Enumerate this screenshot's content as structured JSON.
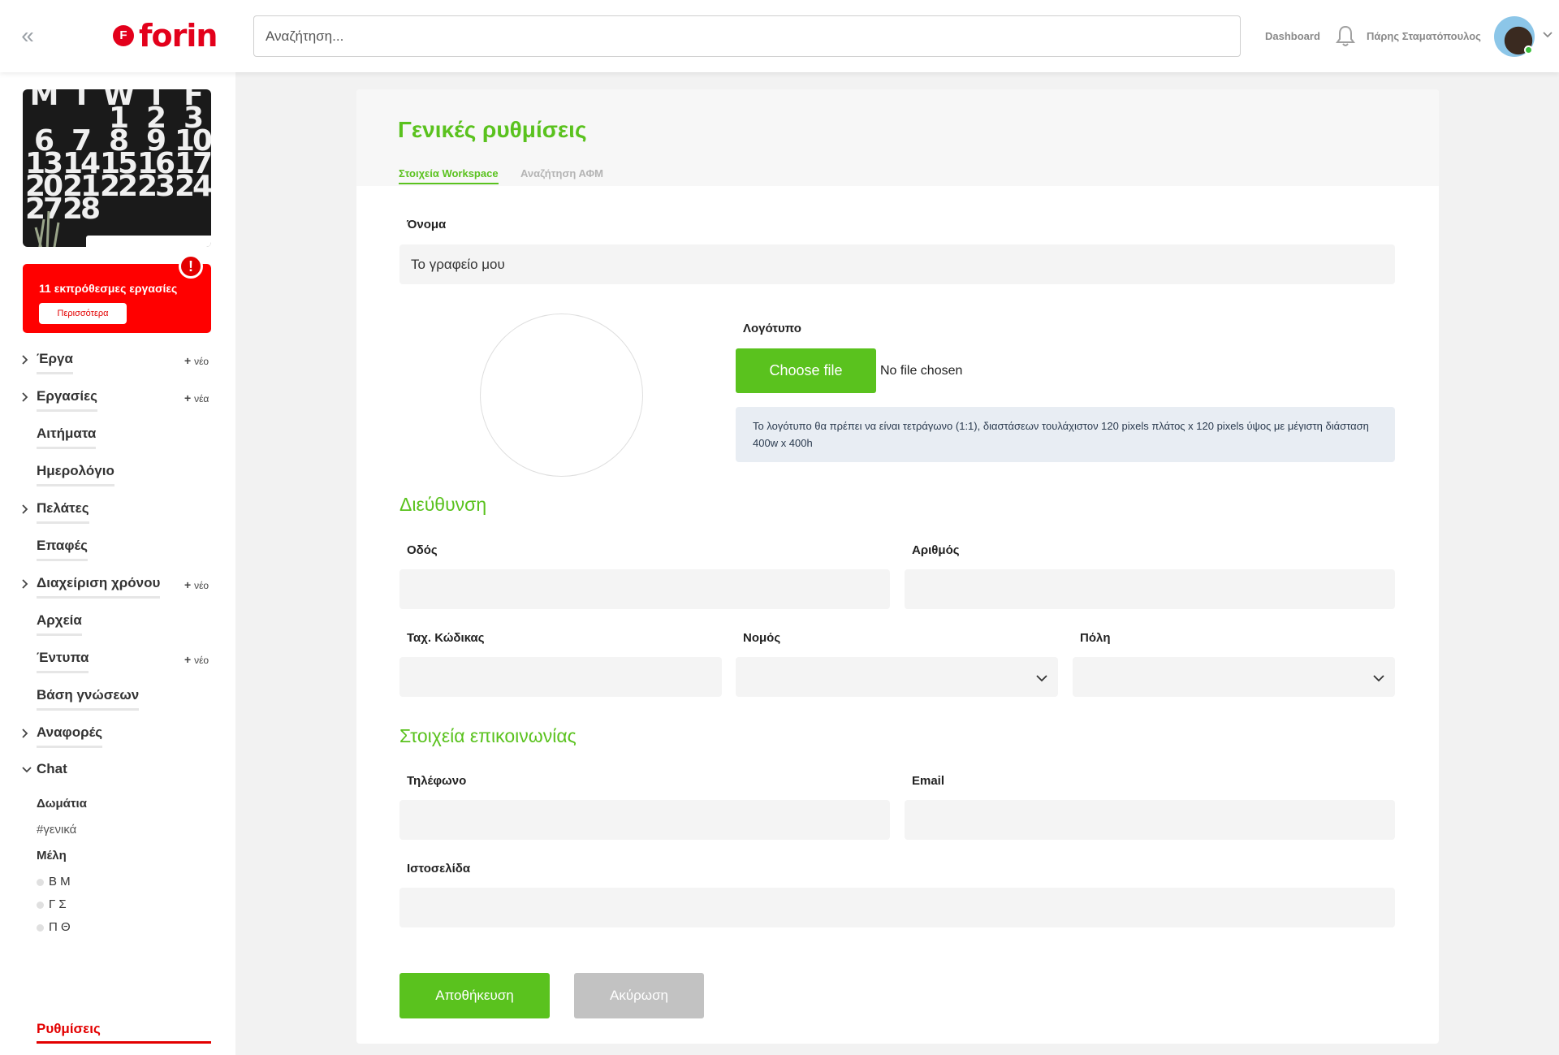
{
  "header": {
    "logo_text": "forin",
    "logo_mark": "F",
    "search_placeholder": "Αναζήτηση...",
    "dashboard_label": "Dashboard",
    "user_name": "Πάρης Σταματόπουλος",
    "icons": [
      "double-chevron-left-icon",
      "bell-icon",
      "chevron-down-icon"
    ]
  },
  "sidebar": {
    "calendar": {
      "rows": [
        [
          "M",
          "T",
          "W",
          "T",
          "F"
        ],
        [
          "",
          "",
          "1",
          "2",
          "3"
        ],
        [
          "6",
          "7",
          "8",
          "9",
          "10"
        ],
        [
          "13",
          "14",
          "15",
          "16",
          "17"
        ],
        [
          "20",
          "21",
          "22",
          "23",
          "24"
        ],
        [
          "27",
          "28",
          "",
          "",
          ""
        ]
      ]
    },
    "alert": {
      "text": "11 εκπρόθεσμες εργασίες",
      "button": "Περισσότερα",
      "badge": "!"
    },
    "nav": [
      {
        "label": "Έργα",
        "expandable": true,
        "new": "νέο"
      },
      {
        "label": "Εργασίες",
        "expandable": true,
        "new": "νέα"
      },
      {
        "label": "Αιτήματα",
        "expandable": false,
        "new": ""
      },
      {
        "label": "Ημερολόγιο",
        "expandable": false,
        "new": ""
      },
      {
        "label": "Πελάτες",
        "expandable": true,
        "new": ""
      },
      {
        "label": "Επαφές",
        "expandable": false,
        "new": ""
      },
      {
        "label": "Διαχείριση χρόνου",
        "expandable": true,
        "new": "νέο"
      },
      {
        "label": "Αρχεία",
        "expandable": false,
        "new": ""
      },
      {
        "label": "Έντυπα",
        "expandable": false,
        "new": "νέο"
      },
      {
        "label": "Βάση γνώσεων",
        "expandable": false,
        "new": ""
      },
      {
        "label": "Αναφορές",
        "expandable": true,
        "new": ""
      }
    ],
    "chat": {
      "label": "Chat",
      "rooms_label": "Δωμάτια",
      "rooms": [
        "#γενικά"
      ],
      "members_label": "Μέλη",
      "members": [
        "Β Μ",
        "Γ Σ",
        "Π Θ"
      ]
    },
    "settings_label": "Ρυθμίσεις"
  },
  "main": {
    "title": "Γενικές ρυθμίσεις",
    "tabs": [
      {
        "label": "Στοιχεία Workspace",
        "active": true
      },
      {
        "label": "Αναζήτηση ΑΦΜ",
        "active": false
      }
    ],
    "name": {
      "label": "Όνομα",
      "value": "Το γραφείο μου"
    },
    "logo": {
      "label": "Λογότυπο",
      "choose_button": "Choose file",
      "no_file": "No file chosen",
      "note": "Το λογότυπο θα πρέπει να είναι τετράγωνο (1:1), διαστάσεων τουλάχιστον 120 pixels πλάτος x 120 pixels ύψος με μέγιστη διάσταση 400w x 400h"
    },
    "address": {
      "section": "Διεύθυνση",
      "street_label": "Οδός",
      "street_value": "",
      "number_label": "Αριθμός",
      "number_value": "",
      "postal_label": "Ταχ. Κώδικας",
      "postal_value": "",
      "prefecture_label": "Νομός",
      "prefecture_value": "",
      "city_label": "Πόλη",
      "city_value": ""
    },
    "contact": {
      "section": "Στοιχεία επικοινωνίας",
      "phone_label": "Τηλέφωνο",
      "phone_value": "",
      "email_label": "Email",
      "email_value": "",
      "website_label": "Ιστοσελίδα",
      "website_value": ""
    },
    "actions": {
      "save": "Αποθήκευση",
      "cancel": "Ακύρωση"
    }
  },
  "colors": {
    "brand_red": "#e3001b",
    "accent_green": "#5ac21e",
    "alert_red": "#ff0000",
    "muted_button": "#c2c2c2"
  }
}
